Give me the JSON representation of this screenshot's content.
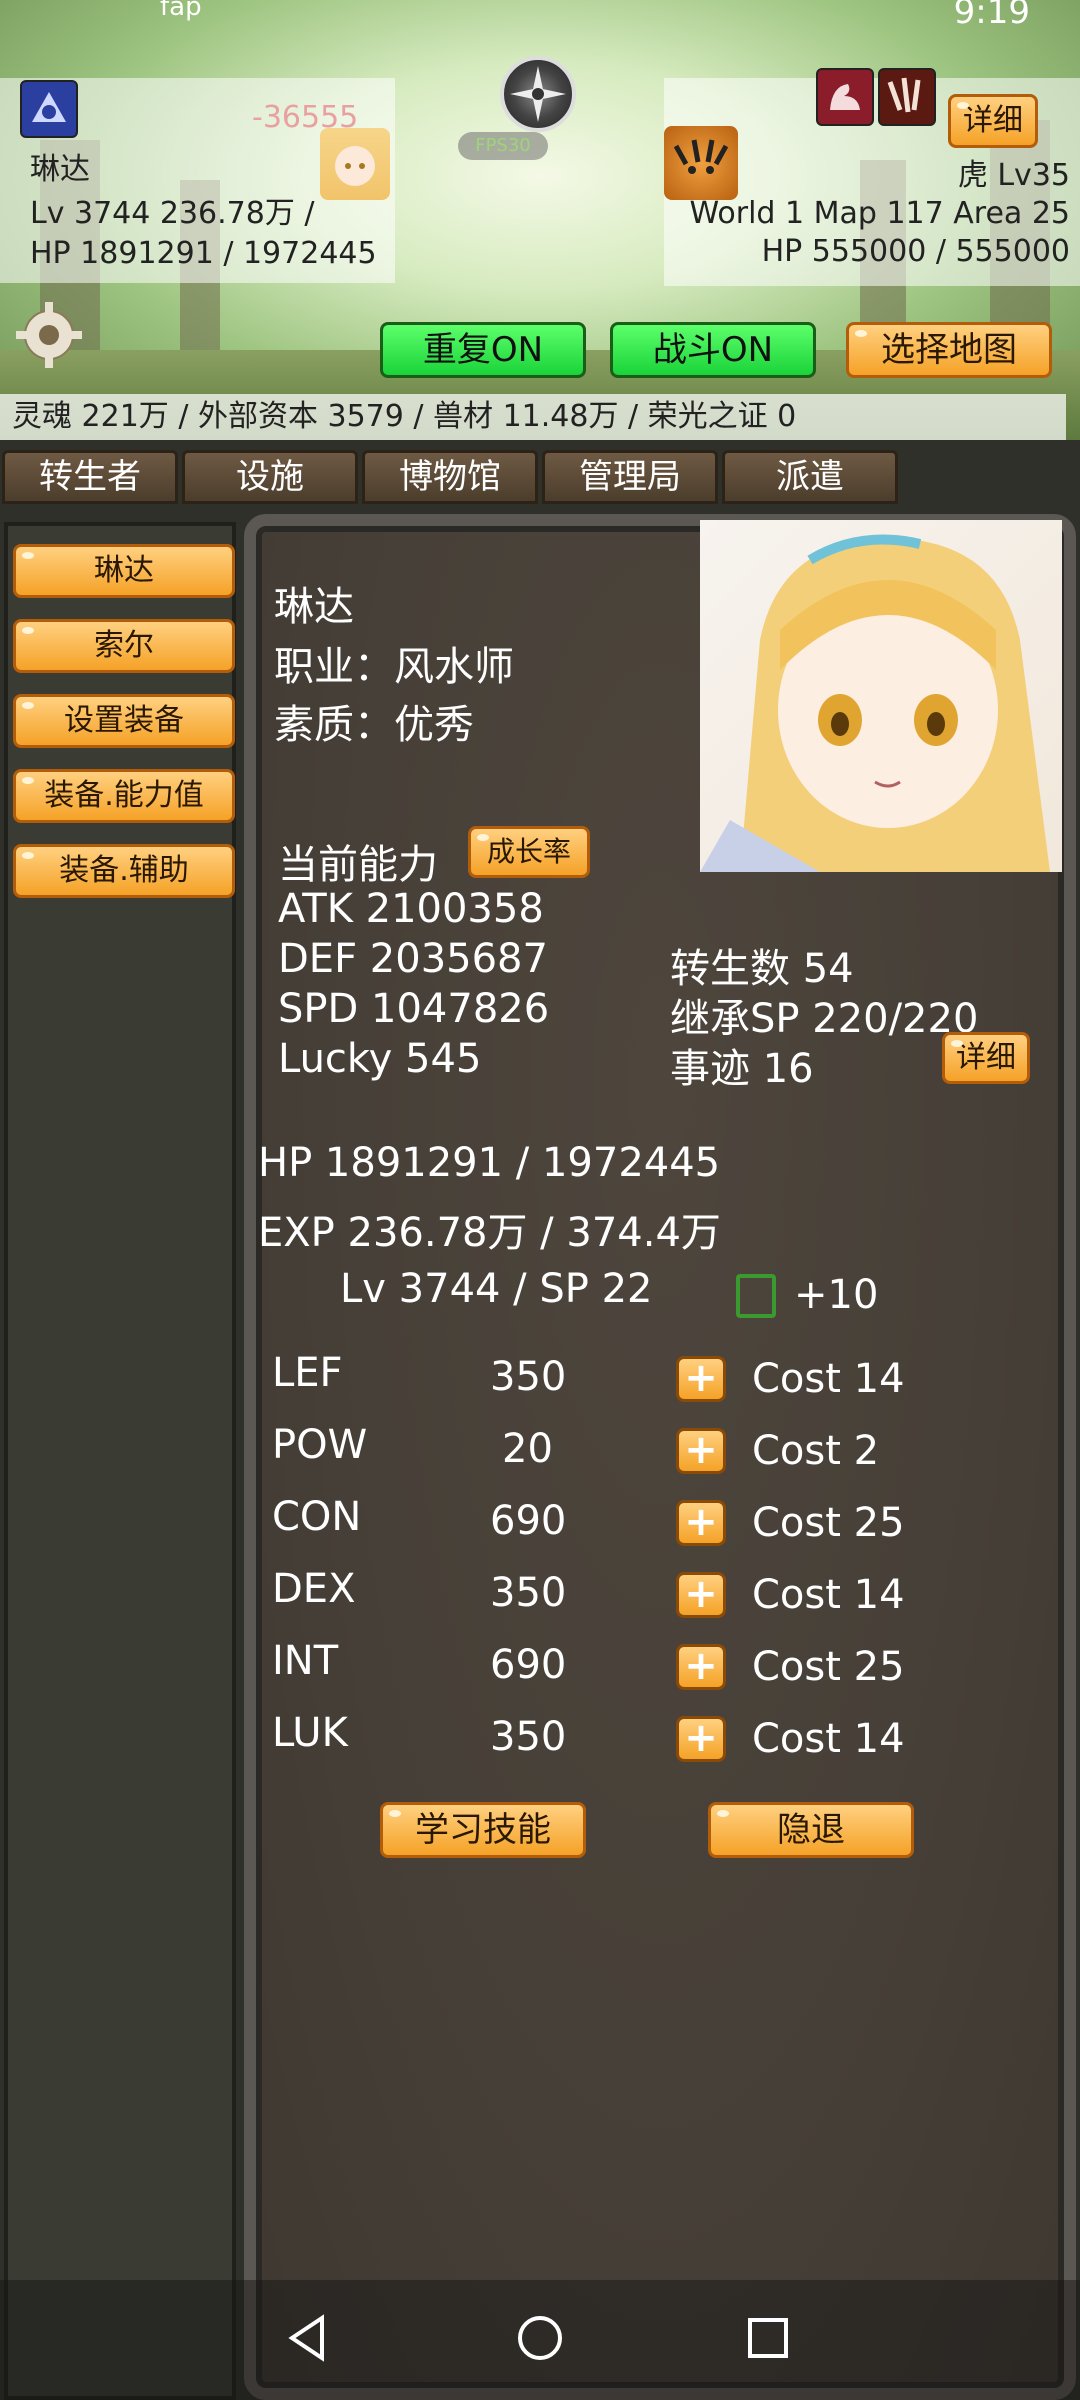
{
  "status_bar": {
    "left_text": "fap",
    "time": "9:19"
  },
  "player": {
    "damage_popup": "-36555",
    "name": "琳达",
    "lv_line": "Lv 3744 236.78万 /",
    "hp_line": "HP 1891291 / 1972445"
  },
  "fps_label": "FPS30",
  "enemy": {
    "name_line": "虎 Lv35",
    "location_line": "World 1 Map 117 Area 25",
    "hp_line": "HP 555000 / 555000",
    "detail_button": "详细"
  },
  "controls": {
    "repeat_button": "重复ON",
    "battle_button": "战斗ON",
    "select_map_button": "选择地图"
  },
  "resources": "灵魂 221万 / 外部资本 3579 / 兽材 11.48万 / 荣光之证 0",
  "tabs": [
    "转生者",
    "设施",
    "博物馆",
    "管理局",
    "派遣"
  ],
  "sidebar": [
    "琳达",
    "索尔",
    "设置装备",
    "装备.能力值",
    "装备.辅助"
  ],
  "character": {
    "name": "琳达",
    "job": "职业：风水师",
    "quality": "素质：优秀",
    "current_ability_label": "当前能力",
    "growth_button": "成长率",
    "atk": "ATK 2100358",
    "def": "DEF 2035687",
    "spd": "SPD 1047826",
    "lucky": "Lucky 545",
    "rebirth": "转生数 54",
    "inherit_sp": "继承SP 220/220",
    "deeds": "事迹 16",
    "deeds_detail_button": "详细",
    "hp": "HP 1891291 / 1972445",
    "exp": "EXP 236.78万 / 374.4万",
    "lv_sp": "Lv 3744 / SP 22",
    "plus_ten": "+10"
  },
  "stats": [
    {
      "name": "LEF",
      "value": "350",
      "cost": "Cost 14"
    },
    {
      "name": "POW",
      "value": "20",
      "cost": "Cost 2"
    },
    {
      "name": "CON",
      "value": "690",
      "cost": "Cost 25"
    },
    {
      "name": "DEX",
      "value": "350",
      "cost": "Cost 14"
    },
    {
      "name": "INT",
      "value": "690",
      "cost": "Cost 25"
    },
    {
      "name": "LUK",
      "value": "350",
      "cost": "Cost 14"
    }
  ],
  "actions": {
    "learn_skill": "学习技能",
    "retire": "隐退"
  },
  "plus_symbol": "+"
}
